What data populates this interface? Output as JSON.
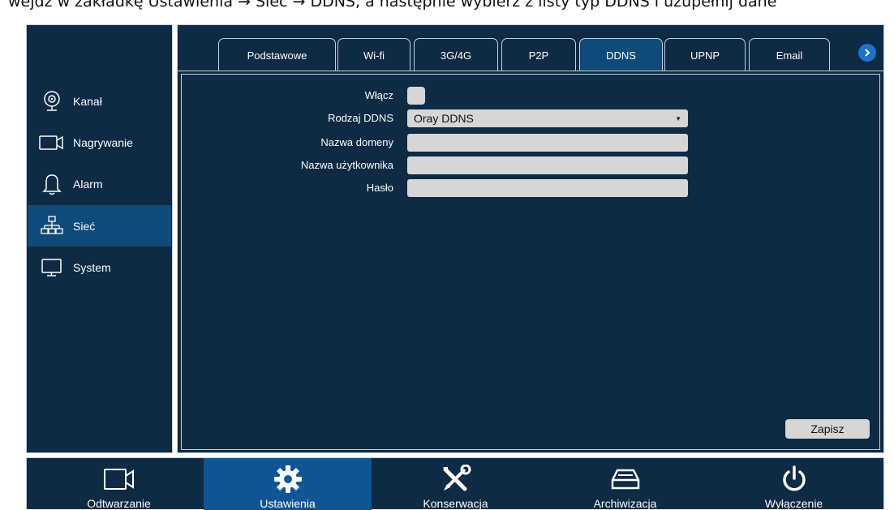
{
  "caption": "wejdź w zakładkę Ustawienia → Sieć → DDNS, a następnie wybierz z listy typ DDNS i uzupełnij dane",
  "sidebar": {
    "items": [
      {
        "label": "Kanał",
        "icon": "camera-icon",
        "active": false
      },
      {
        "label": "Nagrywanie",
        "icon": "video-icon",
        "active": false
      },
      {
        "label": "Alarm",
        "icon": "bell-icon",
        "active": false
      },
      {
        "label": "Sieć",
        "icon": "network-icon",
        "active": true
      },
      {
        "label": "System",
        "icon": "monitor-icon",
        "active": false
      }
    ]
  },
  "tabs": [
    {
      "label": "Podstawowe",
      "active": false
    },
    {
      "label": "Wi-fi",
      "active": false
    },
    {
      "label": "3G/4G",
      "active": false
    },
    {
      "label": "P2P",
      "active": false
    },
    {
      "label": "DDNS",
      "active": true
    },
    {
      "label": "UPNP",
      "active": false
    },
    {
      "label": "Email",
      "active": false
    }
  ],
  "form": {
    "enable_label": "Włącz",
    "enable_checked": false,
    "type_label": "Rodzaj DDNS",
    "type_value": "Oray DDNS",
    "domain_label": "Nazwa domeny",
    "domain_value": "",
    "user_label": "Nazwa użytkownika",
    "user_value": "",
    "password_label": "Hasło",
    "password_value": ""
  },
  "save_label": "Zapisz",
  "bottom": {
    "items": [
      {
        "label": "Odtwarzanie",
        "icon": "playback-icon",
        "active": false
      },
      {
        "label": "Ustawienia",
        "icon": "gear-icon",
        "active": true
      },
      {
        "label": "Konserwacja",
        "icon": "tools-icon",
        "active": false
      },
      {
        "label": "Archiwizacja",
        "icon": "archive-icon",
        "active": false
      },
      {
        "label": "Wyłączenie",
        "icon": "power-icon",
        "active": false
      }
    ]
  },
  "colors": {
    "panel": "#0e2a44",
    "active": "#0f4a78",
    "active_bottom": "#0f5594",
    "field": "#d6d6d6",
    "accent": "#1f73c6"
  }
}
